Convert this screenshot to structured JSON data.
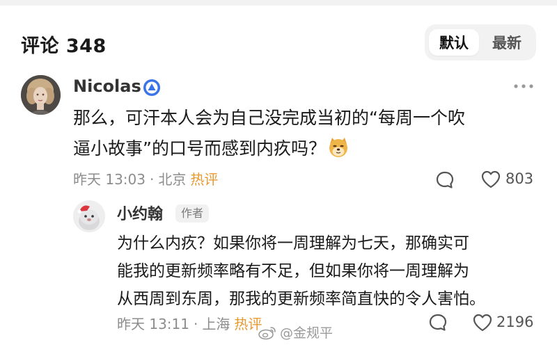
{
  "header": {
    "title": "评论 348",
    "sort_options": [
      {
        "label": "默认",
        "active": true
      },
      {
        "label": "最新",
        "active": false
      }
    ]
  },
  "comment": {
    "username": "Nicolas",
    "badge_icon": "verified-badge-icon",
    "text_line1": "那么，可汗本人会为自己没完成当初的“每周一个吹",
    "text_line2": "逼小故事”的口号而感到内疚吗？",
    "emoji_icon": "doge-emoji-icon",
    "time": "昨天 13:03",
    "separator": "·",
    "location": "北京",
    "hot_label": "热评",
    "likes": "803"
  },
  "reply": {
    "username": "小约翰",
    "author_tag": "作者",
    "text_line1": "为什么内疚？如果你将一周理解为七天，那确实可",
    "text_line2": "能我的更新频率略有不足，但如果你将一周理解为",
    "text_line3": "从西周到东周，那我的更新频率简直快的令人害怕。",
    "time": "昨天 13:11",
    "separator": "·",
    "location": "上海",
    "hot_label": "热评",
    "likes": "2196"
  },
  "watermark": {
    "text": "@金规平"
  },
  "colors": {
    "hot": "#e89a2f",
    "meta": "#8c8c8c",
    "badge": "#3b74e8",
    "toggle_bg": "#f2f2f2"
  }
}
